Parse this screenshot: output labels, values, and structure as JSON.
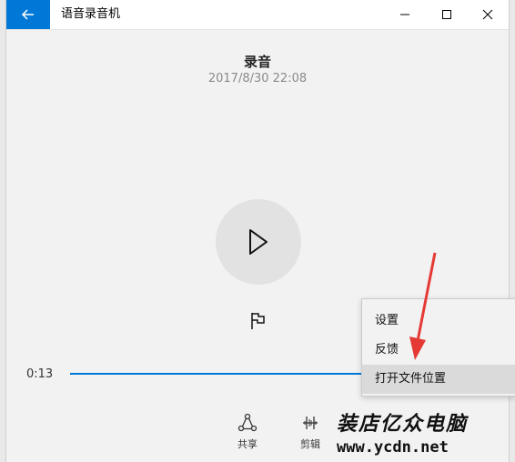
{
  "window": {
    "title": "语音录音机",
    "accent": "#0078d7"
  },
  "icons": {
    "back": "arrow-left-icon",
    "minimize": "minimize-icon",
    "maximize": "maximize-icon",
    "close": "close-icon",
    "play": "play-icon",
    "flag": "flag-icon",
    "share": "share-icon",
    "trim": "trim-icon"
  },
  "recording": {
    "title": "录音",
    "date": "2017/8/30 22:08"
  },
  "player": {
    "time": "0:13",
    "progress_fraction": 0.63
  },
  "toolbar": {
    "share_label": "共享",
    "trim_label": "剪辑"
  },
  "context_menu": {
    "items": [
      "设置",
      "反馈",
      "打开文件位置"
    ],
    "highlighted_index": 2
  },
  "watermark": {
    "line1": "装店亿众电脑",
    "line2": "www.ycdn.net"
  }
}
